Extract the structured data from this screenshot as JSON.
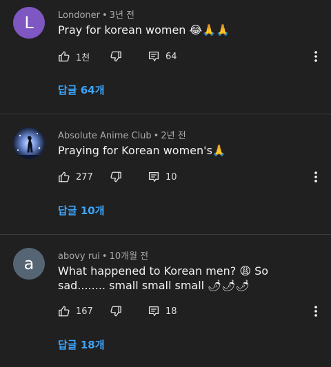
{
  "comments": [
    {
      "author": "Londoner",
      "time": "3년 전",
      "avatar_letter": "L",
      "avatar_color": "#7e57c2",
      "text": "Pray for korean women 😂🙏🙏",
      "likes": "1천",
      "reply_count": "64",
      "replies_link": "답글 64개"
    },
    {
      "author": "Absolute Anime Club",
      "time": "2년 전",
      "avatar_letter": "",
      "avatar_color": "#1a2740",
      "text": "Praying for Korean women's🙏",
      "likes": "277",
      "reply_count": "10",
      "replies_link": "답글 10개"
    },
    {
      "author": "abovy rui",
      "time": "10개월 전",
      "avatar_letter": "a",
      "avatar_color": "#566573",
      "text": "What happened to Korean men? 😩 So sad........ small small small 🌶🌶🌶",
      "likes": "167",
      "reply_count": "18",
      "replies_link": "답글 18개"
    }
  ],
  "icons": {
    "like": "thumb-up-icon",
    "dislike": "thumb-down-icon",
    "reply": "comment-icon",
    "more": "more-vert-icon"
  }
}
